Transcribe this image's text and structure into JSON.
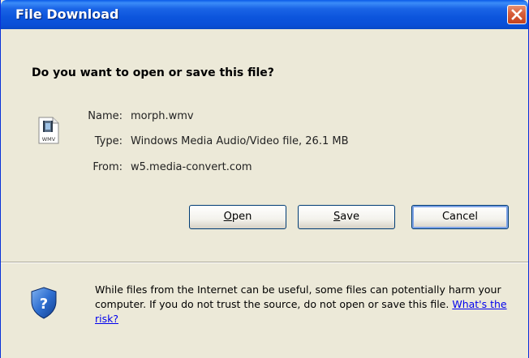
{
  "window": {
    "title": "File Download"
  },
  "prompt": {
    "question": "Do you want to open or save this file?"
  },
  "file": {
    "icon": "wmv-file-icon",
    "icon_caption": "WMV",
    "name_label": "Name:",
    "name_value": "morph.wmv",
    "type_label": "Type:",
    "type_value": "Windows Media Audio/Video file, 26.1 MB",
    "from_label": "From:",
    "from_value": "w5.media-convert.com"
  },
  "buttons": {
    "open_label": "Open",
    "save_label": "Save",
    "cancel_label": "Cancel"
  },
  "warning": {
    "icon": "shield-question-icon",
    "text": "While files from the Internet can be useful, some files can potentially harm your computer. If you do not trust the source, do not open or save this file.",
    "link_text": "What's the risk?"
  },
  "colors": {
    "titlebar_blue": "#0a5ae8",
    "close_red": "#d9603d",
    "dialog_bg": "#ece9d8",
    "link": "#0000ee"
  }
}
